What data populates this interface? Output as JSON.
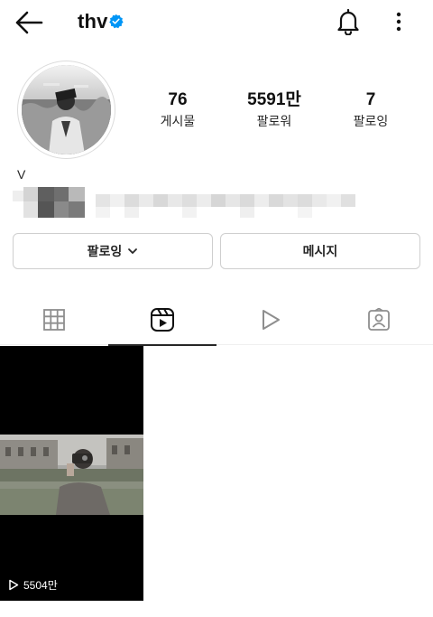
{
  "header": {
    "username": "thv",
    "verified": true,
    "back_icon": "back-arrow-icon",
    "bell_icon": "bell-icon",
    "more_icon": "more-vertical-icon"
  },
  "profile": {
    "display_name": "V",
    "stats": [
      {
        "value": "76",
        "label": "게시물"
      },
      {
        "value": "5591만",
        "label": "팔로워"
      },
      {
        "value": "7",
        "label": "팔로잉"
      }
    ]
  },
  "actions": {
    "follow_label": "팔로잉",
    "message_label": "메시지"
  },
  "tabs": [
    {
      "icon": "grid-icon",
      "active": false
    },
    {
      "icon": "reels-icon",
      "active": true
    },
    {
      "icon": "play-icon",
      "active": false
    },
    {
      "icon": "tagged-icon",
      "active": false
    }
  ],
  "reels": [
    {
      "views": "5504만"
    }
  ],
  "colors": {
    "text": "#262626",
    "verified_blue": "#0095f6",
    "border": "#dbdbdb"
  }
}
